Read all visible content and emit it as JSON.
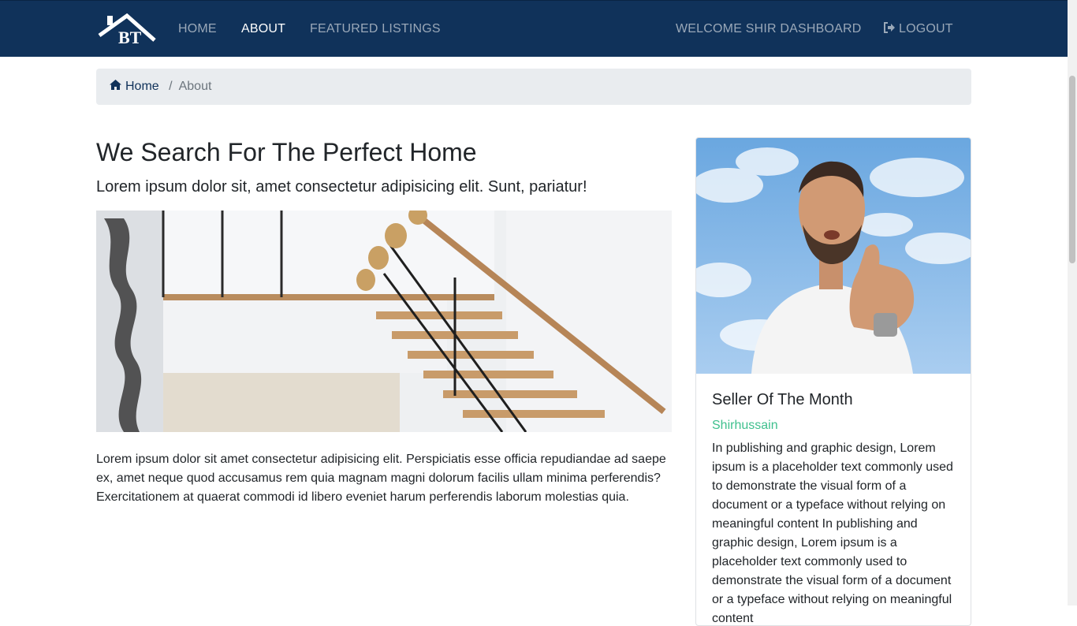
{
  "navbar": {
    "brand_text": "BT",
    "links": [
      {
        "label": "HOME",
        "active": false
      },
      {
        "label": "ABOUT",
        "active": true
      },
      {
        "label": "FEATURED LISTINGS",
        "active": false
      }
    ],
    "welcome_label": "WELCOME SHIR DASHBOARD",
    "logout_label": "LOGOUT",
    "logout_icon": "sign-out-icon",
    "background_color": "#10325a"
  },
  "breadcrumb": {
    "home_icon": "home-icon",
    "home_label": "Home",
    "separator": "/",
    "current": "About"
  },
  "main": {
    "title": "We Search For The Perfect Home",
    "lead": "Lorem ipsum dolor sit, amet consectetur adipisicing elit. Sunt, pariatur!",
    "image_subject": "staircase",
    "body": "Lorem ipsum dolor sit amet consectetur adipisicing elit. Perspiciatis esse officia repudiandae ad saepe ex, amet neque quod accusamus rem quia magnam magni dolorum facilis ullam minima perferendis? Exercitationem at quaerat commodi id libero eveniet harum perferendis laborum molestias quia."
  },
  "seller_card": {
    "image_subject": "seller-photo",
    "title": "Seller Of The Month",
    "name": "Shirhussain",
    "name_color": "#3fc08e",
    "description": "In publishing and graphic design, Lorem ipsum is a placeholder text commonly used to demonstrate the visual form of a document or a typeface without relying on meaningful content In publishing and graphic design, Lorem ipsum is a placeholder text commonly used to demonstrate the visual form of a document or a typeface without relying on meaningful content"
  }
}
